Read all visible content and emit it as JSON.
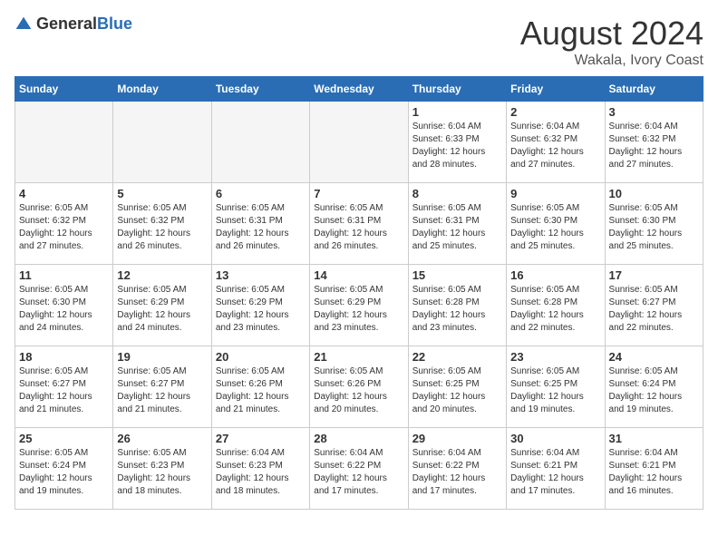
{
  "logo": {
    "general": "General",
    "blue": "Blue"
  },
  "header": {
    "month": "August 2024",
    "location": "Wakala, Ivory Coast"
  },
  "days_of_week": [
    "Sunday",
    "Monday",
    "Tuesday",
    "Wednesday",
    "Thursday",
    "Friday",
    "Saturday"
  ],
  "weeks": [
    [
      {
        "day": "",
        "info": ""
      },
      {
        "day": "",
        "info": ""
      },
      {
        "day": "",
        "info": ""
      },
      {
        "day": "",
        "info": ""
      },
      {
        "day": "1",
        "info": "Sunrise: 6:04 AM\nSunset: 6:33 PM\nDaylight: 12 hours and 28 minutes."
      },
      {
        "day": "2",
        "info": "Sunrise: 6:04 AM\nSunset: 6:32 PM\nDaylight: 12 hours and 27 minutes."
      },
      {
        "day": "3",
        "info": "Sunrise: 6:04 AM\nSunset: 6:32 PM\nDaylight: 12 hours and 27 minutes."
      }
    ],
    [
      {
        "day": "4",
        "info": "Sunrise: 6:05 AM\nSunset: 6:32 PM\nDaylight: 12 hours and 27 minutes."
      },
      {
        "day": "5",
        "info": "Sunrise: 6:05 AM\nSunset: 6:32 PM\nDaylight: 12 hours and 26 minutes."
      },
      {
        "day": "6",
        "info": "Sunrise: 6:05 AM\nSunset: 6:31 PM\nDaylight: 12 hours and 26 minutes."
      },
      {
        "day": "7",
        "info": "Sunrise: 6:05 AM\nSunset: 6:31 PM\nDaylight: 12 hours and 26 minutes."
      },
      {
        "day": "8",
        "info": "Sunrise: 6:05 AM\nSunset: 6:31 PM\nDaylight: 12 hours and 25 minutes."
      },
      {
        "day": "9",
        "info": "Sunrise: 6:05 AM\nSunset: 6:30 PM\nDaylight: 12 hours and 25 minutes."
      },
      {
        "day": "10",
        "info": "Sunrise: 6:05 AM\nSunset: 6:30 PM\nDaylight: 12 hours and 25 minutes."
      }
    ],
    [
      {
        "day": "11",
        "info": "Sunrise: 6:05 AM\nSunset: 6:30 PM\nDaylight: 12 hours and 24 minutes."
      },
      {
        "day": "12",
        "info": "Sunrise: 6:05 AM\nSunset: 6:29 PM\nDaylight: 12 hours and 24 minutes."
      },
      {
        "day": "13",
        "info": "Sunrise: 6:05 AM\nSunset: 6:29 PM\nDaylight: 12 hours and 23 minutes."
      },
      {
        "day": "14",
        "info": "Sunrise: 6:05 AM\nSunset: 6:29 PM\nDaylight: 12 hours and 23 minutes."
      },
      {
        "day": "15",
        "info": "Sunrise: 6:05 AM\nSunset: 6:28 PM\nDaylight: 12 hours and 23 minutes."
      },
      {
        "day": "16",
        "info": "Sunrise: 6:05 AM\nSunset: 6:28 PM\nDaylight: 12 hours and 22 minutes."
      },
      {
        "day": "17",
        "info": "Sunrise: 6:05 AM\nSunset: 6:27 PM\nDaylight: 12 hours and 22 minutes."
      }
    ],
    [
      {
        "day": "18",
        "info": "Sunrise: 6:05 AM\nSunset: 6:27 PM\nDaylight: 12 hours and 21 minutes."
      },
      {
        "day": "19",
        "info": "Sunrise: 6:05 AM\nSunset: 6:27 PM\nDaylight: 12 hours and 21 minutes."
      },
      {
        "day": "20",
        "info": "Sunrise: 6:05 AM\nSunset: 6:26 PM\nDaylight: 12 hours and 21 minutes."
      },
      {
        "day": "21",
        "info": "Sunrise: 6:05 AM\nSunset: 6:26 PM\nDaylight: 12 hours and 20 minutes."
      },
      {
        "day": "22",
        "info": "Sunrise: 6:05 AM\nSunset: 6:25 PM\nDaylight: 12 hours and 20 minutes."
      },
      {
        "day": "23",
        "info": "Sunrise: 6:05 AM\nSunset: 6:25 PM\nDaylight: 12 hours and 19 minutes."
      },
      {
        "day": "24",
        "info": "Sunrise: 6:05 AM\nSunset: 6:24 PM\nDaylight: 12 hours and 19 minutes."
      }
    ],
    [
      {
        "day": "25",
        "info": "Sunrise: 6:05 AM\nSunset: 6:24 PM\nDaylight: 12 hours and 19 minutes."
      },
      {
        "day": "26",
        "info": "Sunrise: 6:05 AM\nSunset: 6:23 PM\nDaylight: 12 hours and 18 minutes."
      },
      {
        "day": "27",
        "info": "Sunrise: 6:04 AM\nSunset: 6:23 PM\nDaylight: 12 hours and 18 minutes."
      },
      {
        "day": "28",
        "info": "Sunrise: 6:04 AM\nSunset: 6:22 PM\nDaylight: 12 hours and 17 minutes."
      },
      {
        "day": "29",
        "info": "Sunrise: 6:04 AM\nSunset: 6:22 PM\nDaylight: 12 hours and 17 minutes."
      },
      {
        "day": "30",
        "info": "Sunrise: 6:04 AM\nSunset: 6:21 PM\nDaylight: 12 hours and 17 minutes."
      },
      {
        "day": "31",
        "info": "Sunrise: 6:04 AM\nSunset: 6:21 PM\nDaylight: 12 hours and 16 minutes."
      }
    ]
  ]
}
